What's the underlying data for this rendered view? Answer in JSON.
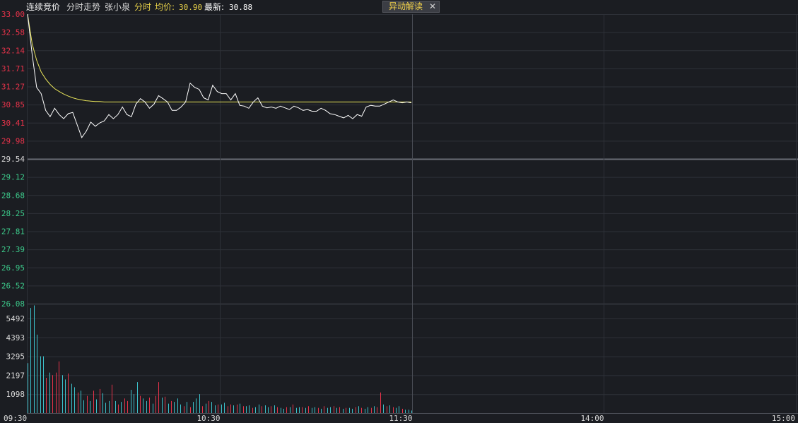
{
  "header": {
    "auction_label": "连续竞价",
    "trend_label": "分时走势",
    "stock_name": "张小泉",
    "mode_tag": "分时",
    "avg_label": "均价:",
    "avg_value": "30.90",
    "last_label": "最新:",
    "last_value": "30.88"
  },
  "anomaly_button": {
    "label": "异动解读",
    "close_glyph": "✕"
  },
  "colors": {
    "background": "#1b1d22",
    "grid": "#2e3138",
    "up": "#e8334a",
    "down": "#3cc98a",
    "neutral": "#d8d8d8",
    "price_line": "#ffffff",
    "avg_line": "#e8e45a",
    "vol_up": "#e8334a",
    "vol_down": "#3cc2cc"
  },
  "chart_data": {
    "type": "line",
    "time_labels": [
      "09:30",
      "10:30",
      "11:30",
      "14:00",
      "15:00"
    ],
    "price_axis": {
      "ticks": [
        "33.00",
        "32.58",
        "32.14",
        "31.71",
        "31.27",
        "30.85",
        "30.41",
        "29.98",
        "29.54",
        "29.12",
        "28.68",
        "28.25",
        "27.81",
        "27.39",
        "26.95",
        "26.52",
        "26.08"
      ],
      "prev_close": 29.54,
      "range": [
        26.08,
        33.0
      ]
    },
    "volume_axis": {
      "ticks": [
        "5492",
        "4393",
        "3295",
        "2197",
        "1098"
      ],
      "range": [
        0,
        6350
      ]
    },
    "price_series": [
      33.0,
      32.05,
      31.25,
      31.1,
      30.7,
      30.55,
      30.75,
      30.6,
      30.5,
      30.62,
      30.65,
      30.35,
      30.05,
      30.2,
      30.42,
      30.32,
      30.4,
      30.45,
      30.6,
      30.5,
      30.6,
      30.78,
      30.6,
      30.55,
      30.85,
      30.98,
      30.9,
      30.75,
      30.85,
      31.05,
      30.98,
      30.9,
      30.7,
      30.7,
      30.78,
      30.9,
      31.35,
      31.25,
      31.2,
      31.0,
      30.95,
      31.3,
      31.15,
      31.1,
      31.1,
      30.95,
      31.1,
      30.82,
      30.8,
      30.75,
      30.9,
      31.0,
      30.8,
      30.76,
      30.78,
      30.75,
      30.8,
      30.76,
      30.72,
      30.8,
      30.76,
      30.7,
      30.72,
      30.68,
      30.68,
      30.75,
      30.7,
      30.62,
      30.6,
      30.56,
      30.52,
      30.58,
      30.5,
      30.6,
      30.56,
      30.78,
      30.82,
      30.8,
      30.8,
      30.85,
      30.9,
      30.95,
      30.9,
      30.88,
      30.9,
      30.88
    ],
    "avg_series": [
      33.0,
      32.3,
      31.9,
      31.62,
      31.45,
      31.32,
      31.22,
      31.15,
      31.09,
      31.04,
      31.0,
      30.97,
      30.95,
      30.93,
      30.92,
      30.91,
      30.91,
      30.9,
      30.9,
      30.9,
      30.9,
      30.9,
      30.9,
      30.9,
      30.9,
      30.9,
      30.9,
      30.9,
      30.9,
      30.9,
      30.9,
      30.9,
      30.9,
      30.9,
      30.9,
      30.9,
      30.9,
      30.9,
      30.9,
      30.9,
      30.9,
      30.9,
      30.9,
      30.9,
      30.9,
      30.9,
      30.9,
      30.9,
      30.9,
      30.9,
      30.9,
      30.9,
      30.9,
      30.9,
      30.9,
      30.9,
      30.9,
      30.9,
      30.9,
      30.9,
      30.9,
      30.9,
      30.9,
      30.9,
      30.9,
      30.9,
      30.9,
      30.9,
      30.9,
      30.9,
      30.9,
      30.9,
      30.9,
      30.9,
      30.9,
      30.9,
      30.9,
      30.9,
      30.9,
      30.9,
      30.9,
      30.9,
      30.9,
      30.9,
      30.9,
      30.9
    ],
    "volume_series": [
      2900,
      6100,
      6250,
      4550,
      3300,
      3300,
      2050,
      2350,
      2200,
      2350,
      3000,
      2200,
      1950,
      2300,
      1700,
      1500,
      1200,
      1300,
      750,
      1000,
      700,
      1300,
      800,
      1400,
      1150,
      600,
      700,
      1650,
      700,
      500,
      650,
      850,
      700,
      1350,
      1100,
      1800,
      1000,
      850,
      700,
      900,
      550,
      1000,
      1800,
      900,
      950,
      550,
      700,
      650,
      850,
      500,
      400,
      650,
      350,
      650,
      850,
      1100,
      400,
      550,
      700,
      650,
      450,
      500,
      500,
      600,
      400,
      500,
      450,
      500,
      550,
      400,
      400,
      450,
      300,
      350,
      500,
      400,
      450,
      350,
      400,
      450,
      350,
      300,
      250,
      350,
      350,
      500,
      300,
      350,
      350,
      300,
      400,
      300,
      350,
      300,
      250,
      400,
      300,
      350,
      400,
      300,
      350,
      250,
      300,
      300,
      250,
      350,
      400,
      300,
      250,
      350,
      300,
      400,
      350,
      1200,
      500,
      400,
      450,
      350,
      300,
      400,
      250,
      200,
      200,
      150
    ],
    "volume_up": [
      false,
      false,
      false,
      false,
      false,
      false,
      true,
      false,
      true,
      true,
      true,
      false,
      false,
      true,
      false,
      false,
      true,
      false,
      false,
      true,
      false,
      true,
      false,
      true,
      false,
      false,
      false,
      true,
      false,
      true,
      false,
      true,
      true,
      false,
      false,
      false,
      true,
      false,
      false,
      true,
      false,
      true,
      true,
      false,
      true,
      false,
      true,
      false,
      false,
      false,
      true,
      false,
      true,
      false,
      false,
      false,
      true,
      false,
      true,
      false,
      false,
      true,
      false,
      false,
      true,
      true,
      false,
      true,
      false,
      true,
      false,
      false,
      true,
      false,
      false,
      true,
      false,
      false,
      true,
      false,
      true,
      false,
      false,
      true,
      false,
      true,
      false,
      false,
      true,
      false,
      true,
      false,
      false,
      true,
      false,
      true,
      false,
      false,
      true,
      false,
      true,
      false,
      true,
      false,
      false,
      true,
      false,
      true,
      false,
      false,
      true,
      false,
      true,
      true,
      false,
      true,
      false,
      true,
      false,
      false,
      true,
      false,
      false
    ]
  }
}
